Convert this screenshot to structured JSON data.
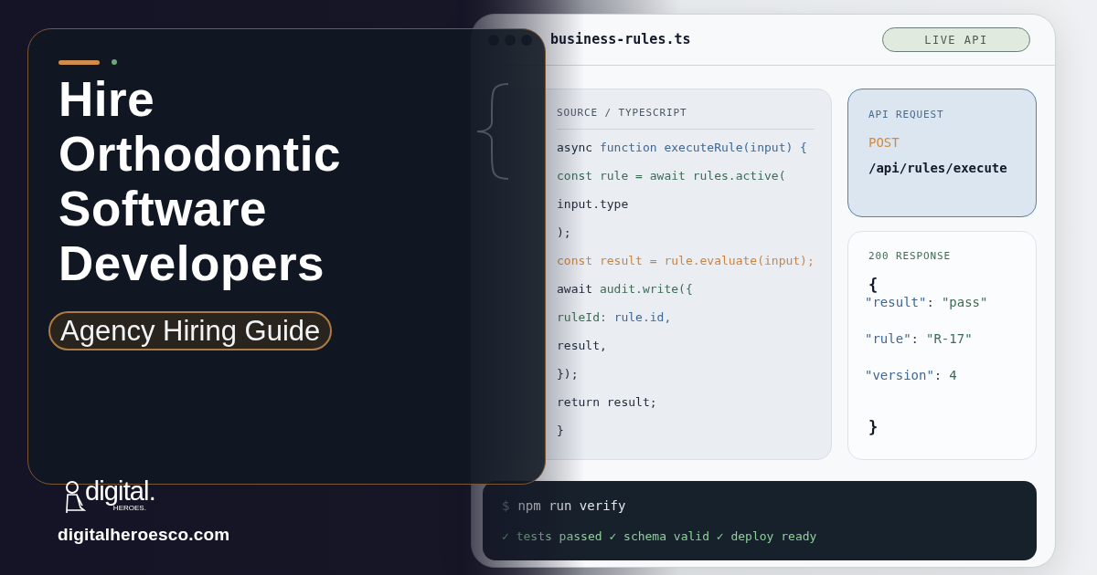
{
  "card": {
    "title_lines": [
      "Hire",
      "Orthodontic",
      "Software",
      "Developers"
    ],
    "subtitle": "Agency Hiring Guide"
  },
  "brand": {
    "wordmark": "digital.",
    "tagline": "HEROES.",
    "website": "digitalheroesco.com"
  },
  "editor": {
    "file_name": "business-rules.ts",
    "badge": "LIVE API",
    "code": {
      "label": "SOURCE / TYPESCRIPT",
      "lines": [
        [
          {
            "text": "async ",
            "kind": "plain"
          },
          {
            "text": "function executeRule(input) {",
            "kind": "keyword"
          }
        ],
        [
          {
            "text": "const rule = await rules.active(",
            "kind": "call"
          }
        ],
        [
          {
            "text": "input.type",
            "kind": "plain"
          }
        ],
        [
          {
            "text": ");",
            "kind": "plain"
          }
        ],
        [
          {
            "text": "const result = rule.evaluate(input);",
            "kind": "accent"
          }
        ],
        [
          {
            "text": "await ",
            "kind": "plain"
          },
          {
            "text": "audit.write({",
            "kind": "call"
          }
        ],
        [
          {
            "text": "ruleId: ",
            "kind": "call"
          },
          {
            "text": "rule.id,",
            "kind": "keyword"
          }
        ],
        [
          {
            "text": "result,",
            "kind": "plain"
          }
        ],
        [
          {
            "text": "});",
            "kind": "plain"
          }
        ],
        [
          {
            "text": "return result;",
            "kind": "plain"
          }
        ],
        [
          {
            "text": "}",
            "kind": "plain"
          }
        ]
      ]
    },
    "request": {
      "label": "API REQUEST",
      "method": "POST",
      "path": "/api/rules/execute"
    },
    "response": {
      "label": "200 RESPONSE",
      "open": "{",
      "fields": [
        {
          "key": "\"result\"",
          "separator": ":",
          "value": "\"pass\""
        },
        {
          "key": "\"rule\"",
          "separator": ":",
          "value": "\"R-17\""
        },
        {
          "key": "\"version\"",
          "separator": ":",
          "value": "4"
        }
      ],
      "close": "}"
    },
    "terminal": {
      "prompt": "$",
      "command": "npm run verify",
      "result": "✓ tests passed ✓ schema valid ✓ deploy ready"
    }
  }
}
